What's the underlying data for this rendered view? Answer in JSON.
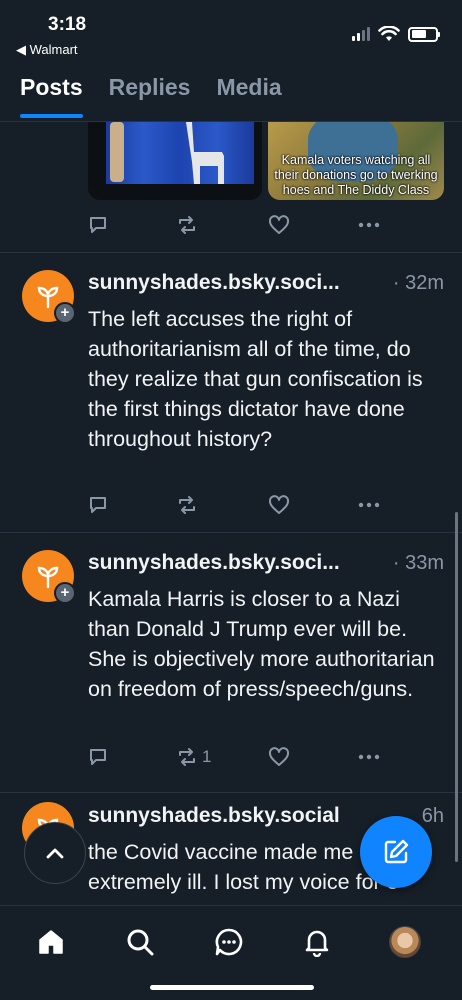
{
  "status_bar": {
    "time": "3:18",
    "back_app": "◀ Walmart"
  },
  "tabs": [
    {
      "label": "Posts",
      "active": true
    },
    {
      "label": "Replies",
      "active": false
    },
    {
      "label": "Media",
      "active": false
    }
  ],
  "top_post": {
    "image_caption": "Kamala voters watching all their donations go to twerking hoes and The Diddy Class"
  },
  "posts": [
    {
      "handle": "sunnyshades.bsky.soci...",
      "time": "· 32m",
      "text": "The left accuses the right of authoritarianism all of the time, do they realize that gun confiscation is the first things dictator have done throughout history?",
      "repost_count": ""
    },
    {
      "handle": "sunnyshades.bsky.soci...",
      "time": "· 33m",
      "text": "Kamala Harris is closer to a Nazi than Donald J Trump ever will be. She is objectively more authoritarian on freedom of press/speech/guns.",
      "repost_count": "1"
    },
    {
      "handle": "sunnyshades.bsky.social",
      "time": "6h",
      "text": "the Covid vaccine made me extremely ill. I lost my voice for 3"
    }
  ],
  "icons": {
    "avatar_badge": "+",
    "colors": {
      "accent": "#1083fe",
      "avatar_bg": "#f6871f",
      "background": "#161e27",
      "muted": "#8a97a6"
    }
  }
}
